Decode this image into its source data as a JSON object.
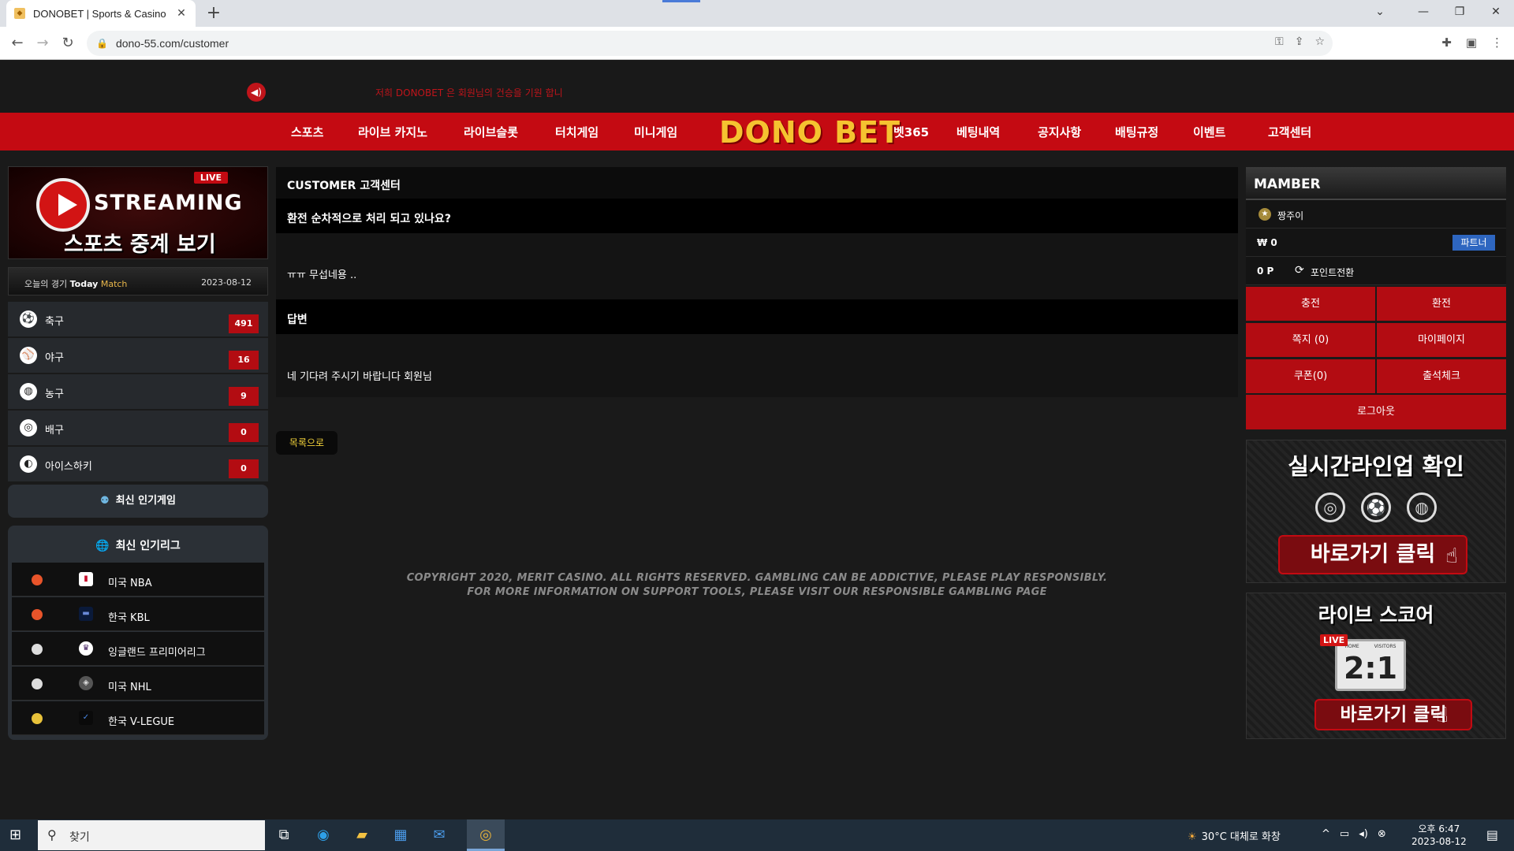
{
  "browser": {
    "tab_title": "DONOBET | Sports & Casino",
    "url": "dono-55.com/customer",
    "new_tab": "+",
    "tab_close": "✕"
  },
  "topbar": {
    "marquee": "저희 DONOBET 은 회원님의 건승을 기원 합니"
  },
  "nav": {
    "left": [
      "스포츠",
      "라이브 카지노",
      "라이브슬롯",
      "터치게임",
      "미니게임"
    ],
    "logo": "DONO BET",
    "right": [
      "벳365",
      "베팅내역",
      "공지사항",
      "배팅규정",
      "이벤트",
      "고객센터"
    ]
  },
  "sidebar": {
    "streaming": {
      "live": "LIVE",
      "title": "STREAMING",
      "subtitle": "스포츠 중계 보기"
    },
    "today": {
      "label_ko": "오늘의 경기",
      "label_today": "Today",
      "label_match": "Match",
      "date": "2023-08-12"
    },
    "sports": [
      {
        "name": "축구",
        "count": "491",
        "icon": "soccer-ball-icon"
      },
      {
        "name": "야구",
        "count": "16",
        "icon": "baseball-icon"
      },
      {
        "name": "농구",
        "count": "9",
        "icon": "basketball-icon"
      },
      {
        "name": "배구",
        "count": "0",
        "icon": "volleyball-icon"
      },
      {
        "name": "아이스하키",
        "count": "0",
        "icon": "hockey-icon"
      }
    ],
    "popular_games": "최신 인기게임",
    "popular_leagues": "최신 인기리그",
    "leagues": [
      {
        "name": "미국 NBA",
        "ball_color": "#e8542a"
      },
      {
        "name": "한국 KBL",
        "ball_color": "#e8542a"
      },
      {
        "name": "잉글랜드 프리미어리그",
        "ball_color": "#dddddd"
      },
      {
        "name": "미국 NHL",
        "ball_color": "#dddddd"
      },
      {
        "name": "한국 V-LEGUE",
        "ball_color": "#e8c23a"
      }
    ]
  },
  "content": {
    "section_title": "CUSTOMER 고객센터",
    "question_title": "환전 순차적으로 처리 되고 있나요?",
    "question_body": "ㅠㅠ 무섭네용 ..",
    "answer_title": "답변",
    "answer_body": "네 기다려 주시기 바랍니다 회원님",
    "list_button": "목록으로",
    "copyright_line1": "COPYRIGHT 2020, MERIT CASINO. ALL RIGHTS RESERVED. GAMBLING CAN BE ADDICTIVE, PLEASE PLAY RESPONSIBLY.",
    "copyright_line2": "FOR MORE INFORMATION ON SUPPORT TOOLS, PLEASE VISIT OUR RESPONSIBLE GAMBLING PAGE"
  },
  "member": {
    "header": "MAMBER",
    "username": "짱주이",
    "balance": "₩ 0",
    "partner_label": "파트너",
    "points": "0 P",
    "convert_label": "포인트전환",
    "buttons": [
      "충전",
      "환전",
      "쪽지 (0)",
      "마이페이지",
      "쿠폰(0)",
      "출석체크"
    ],
    "logout": "로그아웃"
  },
  "banners": {
    "lineup_title": "실시간라인업 확인",
    "lineup_button": "바로가기 클릭",
    "score_title": "라이브 스코어",
    "score_live": "LIVE",
    "score_home": "HOME",
    "score_visitors": "VISITORS",
    "score_value": "2:1",
    "score_button": "바로가기 클릭"
  },
  "taskbar": {
    "search_placeholder": "찾기",
    "weather": "30°C 대체로 화창",
    "time": "오후 6:47",
    "date": "2023-08-12"
  },
  "colors": {
    "brand_red": "#c40a12",
    "logo_gold": "#f5c330",
    "partner_blue": "#2e66c0",
    "list_button_text": "#f3d23a"
  }
}
